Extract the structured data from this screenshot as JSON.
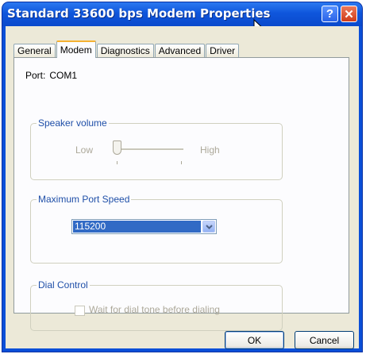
{
  "window": {
    "title": "Standard 33600 bps Modem Properties",
    "help_glyph": "?",
    "close_glyph": "✕"
  },
  "tabs": [
    {
      "label": "General",
      "active": false
    },
    {
      "label": "Modem",
      "active": true
    },
    {
      "label": "Diagnostics",
      "active": false
    },
    {
      "label": "Advanced",
      "active": false
    },
    {
      "label": "Driver",
      "active": false
    }
  ],
  "port": {
    "label": "Port:",
    "value": "COM1"
  },
  "speaker_volume": {
    "title": "Speaker volume",
    "low_label": "Low",
    "high_label": "High",
    "level": 0,
    "enabled": false
  },
  "max_port_speed": {
    "title": "Maximum Port Speed",
    "selected": "115200"
  },
  "dial_control": {
    "title": "Dial Control",
    "checkbox_label": "Wait for dial tone before dialing",
    "checked": false,
    "enabled": false
  },
  "buttons": {
    "ok": "OK",
    "cancel": "Cancel"
  },
  "colors": {
    "titlebar": "#0a4fd8",
    "selection": "#316ac5",
    "close": "#cf3c1a"
  }
}
